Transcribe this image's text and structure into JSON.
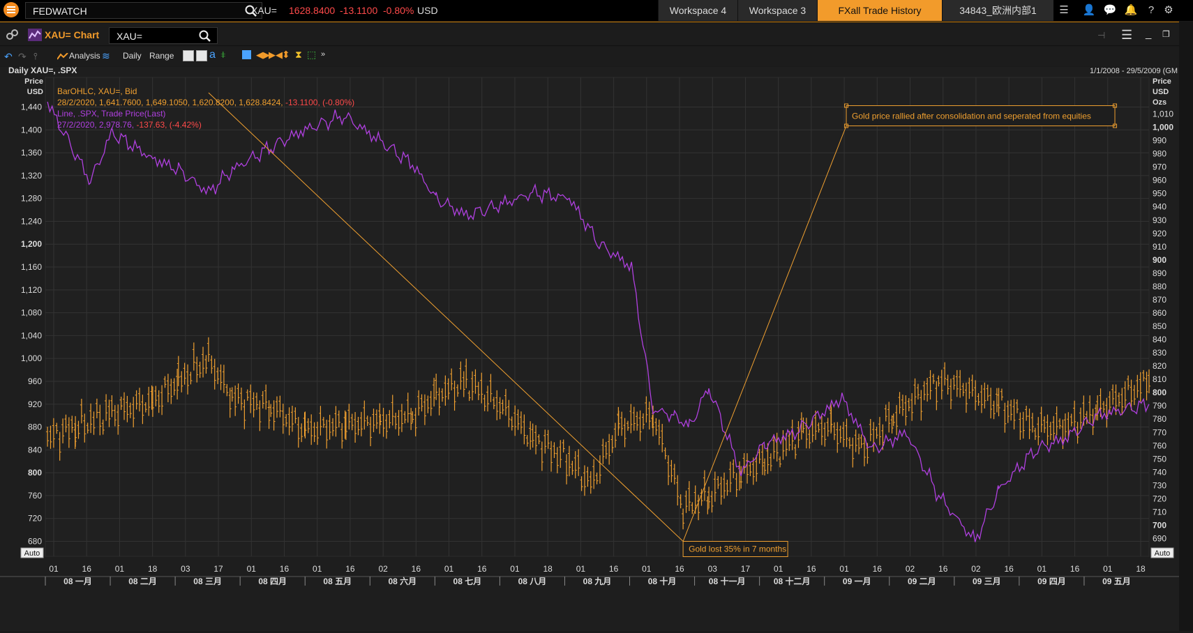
{
  "topbar": {
    "search_value": "FEDWATCH",
    "quote": {
      "ric": "XAU=",
      "price": "1628.8400",
      "change": "-13.1100",
      "pct": "-0.80%",
      "ccy": "USD"
    },
    "tabs": [
      "Workspace 4",
      "Workspace 3",
      "FXall Trade History",
      "34843_欧洲内部1"
    ]
  },
  "window": {
    "title": "XAU= Chart",
    "ric_input": "XAU="
  },
  "toolbar": {
    "analysis": "Analysis",
    "interval": "Daily",
    "range": "Range"
  },
  "chart_data": {
    "type": "line",
    "title": "Daily XAU=, .SPX",
    "date_range": "1/1/2008 - 29/5/2009 (GM",
    "legend": [
      {
        "name": "BarOHLC, XAU=, Bid",
        "values": "28/2/2020, 1,641.7600, 1,649.1050, 1,620.8200, 1,628.8424,",
        "change": "-13.1100, (-0.80%)",
        "color": "#f0a030"
      },
      {
        "name": "Line, .SPX, Trade Price(Last)",
        "values": "27/2/2020, 2,978.76,",
        "change": "-137.63, (-4.42%)",
        "color": "#b040e0"
      }
    ],
    "left_axis": {
      "unit_lines": [
        "Price",
        "USD"
      ],
      "ticks": [
        "1,440",
        "1,400",
        "1,360",
        "1,320",
        "1,280",
        "1,240",
        "1,200",
        "1,160",
        "1,120",
        "1,080",
        "1,040",
        "1,000",
        "960",
        "920",
        "880",
        "840",
        "800",
        "760",
        "720",
        "680"
      ],
      "ylim": [
        672,
        1448
      ]
    },
    "right_axis": {
      "unit_lines": [
        "Price",
        "USD",
        "Ozs"
      ],
      "ticks": [
        "1,010",
        "1,000",
        "990",
        "980",
        "970",
        "960",
        "950",
        "940",
        "930",
        "920",
        "910",
        "900",
        "890",
        "880",
        "870",
        "860",
        "850",
        "840",
        "830",
        "820",
        "810",
        "800",
        "790",
        "780",
        "770",
        "760",
        "750",
        "740",
        "730",
        "720",
        "710",
        "700",
        "690"
      ]
    },
    "x_day_labels": [
      "01",
      "16",
      "01",
      "18",
      "03",
      "17",
      "01",
      "16",
      "01",
      "16",
      "02",
      "16",
      "01",
      "16",
      "01",
      "18",
      "01",
      "16",
      "01",
      "16",
      "03",
      "17",
      "01",
      "16",
      "01",
      "16",
      "02",
      "16",
      "02",
      "16",
      "01",
      "16",
      "01",
      "18"
    ],
    "x_month_labels": [
      "08 一月",
      "08 二月",
      "08 三月",
      "08 四月",
      "08 五月",
      "08 六月",
      "08 七月",
      "08 八月",
      "08 九月",
      "08 十月",
      "08 十一月",
      "08 十二月",
      "09 一月",
      "09 二月",
      "09 三月",
      "09 四月",
      "09 五月"
    ],
    "auto_label": "Auto",
    "series": [
      {
        "name": "XAU= (BarOHLC)",
        "color": "#f0a030",
        "anchor_dates": [
          "2008-01-02",
          "2008-01-15",
          "2008-02-01",
          "2008-02-20",
          "2008-03-03",
          "2008-03-17",
          "2008-03-28",
          "2008-04-15",
          "2008-05-01",
          "2008-05-20",
          "2008-06-05",
          "2008-06-20",
          "2008-07-01",
          "2008-07-15",
          "2008-08-01",
          "2008-08-15",
          "2008-09-01",
          "2008-09-11",
          "2008-09-24",
          "2008-10-10",
          "2008-10-24",
          "2008-11-05",
          "2008-11-20",
          "2008-12-01",
          "2008-12-19",
          "2009-01-01",
          "2009-01-15",
          "2009-01-30",
          "2009-02-20",
          "2009-03-02",
          "2009-03-20",
          "2009-04-06",
          "2009-04-20",
          "2009-05-05",
          "2009-05-29"
        ],
        "anchor_values": [
          860,
          880,
          905,
          925,
          960,
          1000,
          930,
          915,
          875,
          885,
          890,
          900,
          935,
          960,
          915,
          860,
          820,
          780,
          880,
          900,
          740,
          760,
          800,
          820,
          870,
          880,
          840,
          900,
          960,
          950,
          920,
          880,
          880,
          910,
          960
        ]
      },
      {
        "name": ".SPX (Line)",
        "color": "#b040e0",
        "anchor_dates": [
          "2008-01-02",
          "2008-01-22",
          "2008-02-01",
          "2008-02-20",
          "2008-03-03",
          "2008-03-17",
          "2008-03-28",
          "2008-04-15",
          "2008-05-01",
          "2008-05-19",
          "2008-06-05",
          "2008-06-20",
          "2008-07-01",
          "2008-07-15",
          "2008-08-01",
          "2008-08-15",
          "2008-09-01",
          "2008-09-15",
          "2008-09-30",
          "2008-10-10",
          "2008-10-20",
          "2008-10-27",
          "2008-11-05",
          "2008-11-20",
          "2008-12-01",
          "2008-12-15",
          "2009-01-06",
          "2009-01-20",
          "2009-02-05",
          "2009-02-20",
          "2009-03-09",
          "2009-03-20",
          "2009-04-06",
          "2009-04-20",
          "2009-05-05",
          "2009-05-29"
        ],
        "anchor_values": [
          1447,
          1310,
          1395,
          1350,
          1330,
          1290,
          1330,
          1370,
          1400,
          1425,
          1380,
          1340,
          1280,
          1250,
          1270,
          1290,
          1280,
          1200,
          1160,
          910,
          900,
          880,
          950,
          800,
          850,
          870,
          930,
          840,
          870,
          760,
          680,
          770,
          840,
          860,
          900,
          920
        ]
      }
    ],
    "annotations": [
      {
        "text": "Gold lost 35% in 7 months",
        "from_date": "2008-03-17",
        "from_value": 1465,
        "to_date": "2008-10-24",
        "to_value": 680
      },
      {
        "text": "Gold price rallied after consolidation and seperated from equities",
        "from_date": "2008-10-24",
        "from_value": 680,
        "to_date": "2009-01-08",
        "to_value": 1407
      }
    ]
  }
}
